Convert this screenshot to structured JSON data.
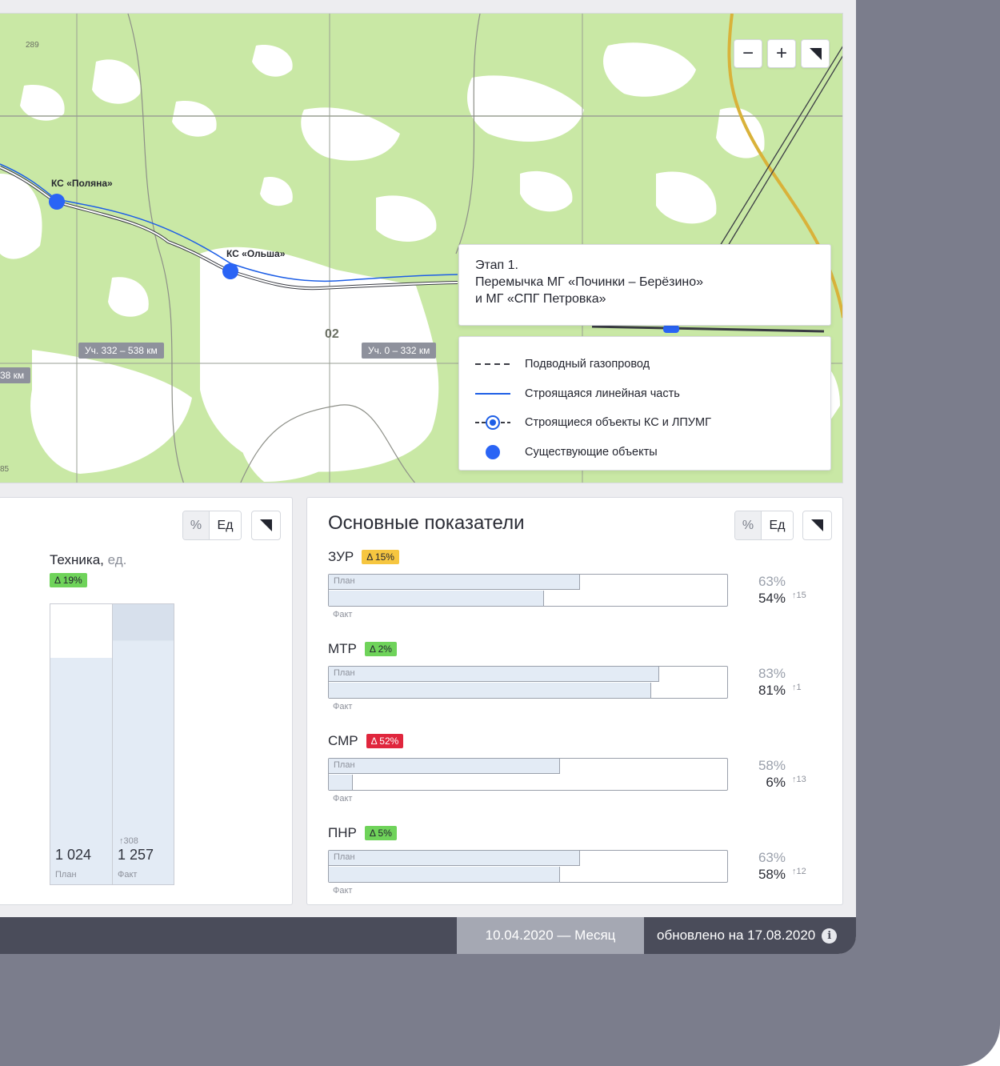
{
  "map": {
    "controls": {
      "zoom_out": "−",
      "zoom_in": "+"
    },
    "stations": [
      "КС «Поляна»",
      "КС «Ольша»"
    ],
    "segments": [
      "Уч. 332 – 538 км",
      "Уч. 0 – 332 км",
      "38 км"
    ],
    "zone_number": "02",
    "grid_numbers": [
      "289",
      "85"
    ],
    "info_card": {
      "line1": "Этап 1.",
      "line2": "Перемычка МГ «Починки – Берёзино»",
      "line3": "и МГ «СПГ Петровка»"
    },
    "legend": [
      {
        "label": "Подводный газопровод",
        "symbol": "dashed-line"
      },
      {
        "label": "Строящаяся линейная часть",
        "symbol": "blue-line"
      },
      {
        "label": "Строящиеся объекты КС и ЛПУМГ",
        "symbol": "gear-node"
      },
      {
        "label": "Существующие объекты",
        "symbol": "blue-dot"
      }
    ],
    "colors": {
      "forest": "#c9e8a5",
      "route": "#1e5fe6",
      "accent": "#2a64f5"
    }
  },
  "toggle": {
    "percent": "%",
    "units": "Ед"
  },
  "tech": {
    "title": "Техника,",
    "unit": "ед.",
    "delta": "Δ 19%",
    "plan_value": "1 024",
    "plan_label": "План",
    "fact_value": "1 257",
    "fact_label": "Факт",
    "fact_diff": "↑308",
    "plan_fill": 0.81,
    "fact_fill": 1.0
  },
  "kpi": {
    "title": "Основные показатели",
    "plan_label": "План",
    "fact_label": "Факт",
    "items": [
      {
        "name": "ЗУР",
        "delta": "Δ 15%",
        "status": "yellow",
        "plan": "63%",
        "fact": "54%",
        "diff": "↑15",
        "plan_val": 0.63,
        "fact_val": 0.54
      },
      {
        "name": "МТР",
        "delta": "Δ 2%",
        "status": "green",
        "plan": "83%",
        "fact": "81%",
        "diff": "↑1",
        "plan_val": 0.83,
        "fact_val": 0.81
      },
      {
        "name": "СМР",
        "delta": "Δ 52%",
        "status": "red",
        "plan": "58%",
        "fact": "6%",
        "diff": "↑13",
        "plan_val": 0.58,
        "fact_val": 0.06
      },
      {
        "name": "ПНР",
        "delta": "Δ 5%",
        "status": "green",
        "plan": "63%",
        "fact": "58%",
        "diff": "↑12",
        "plan_val": 0.63,
        "fact_val": 0.58
      }
    ]
  },
  "footer": {
    "period": "10.04.2020 — Месяц",
    "updated": "обновлено на 17.08.2020",
    "info_icon": "i"
  }
}
